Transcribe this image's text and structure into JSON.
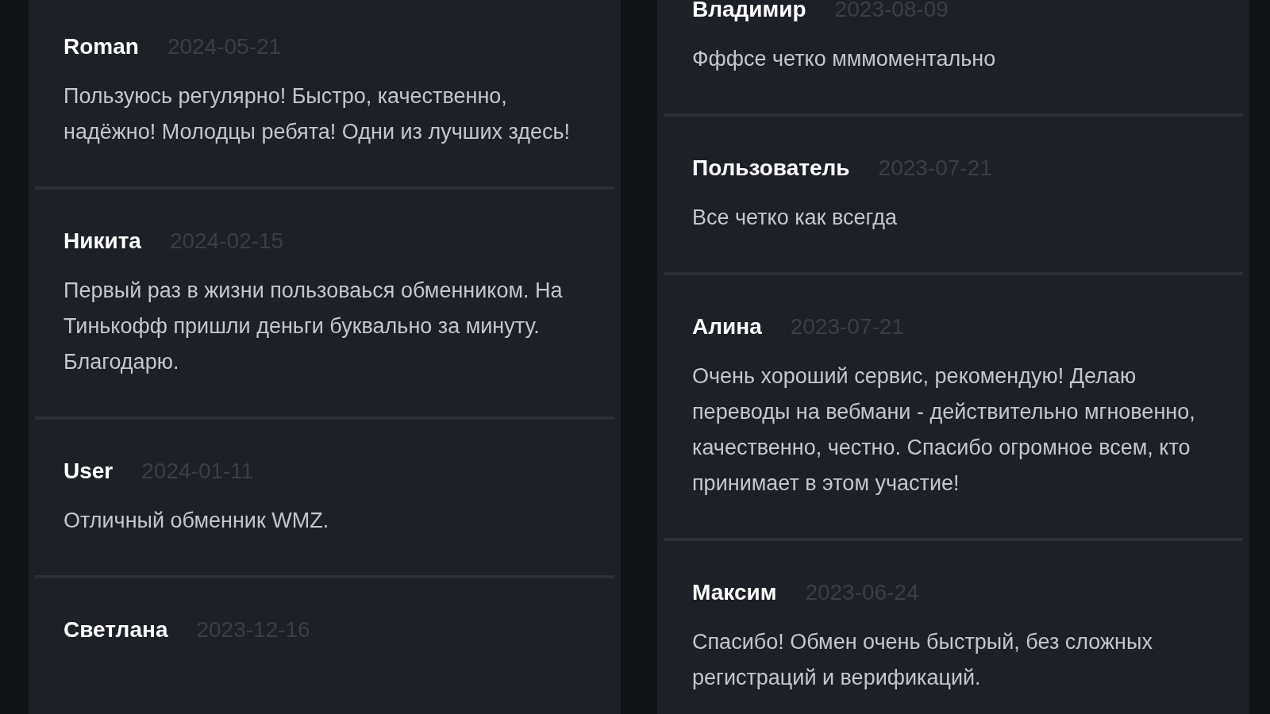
{
  "columns": [
    {
      "reviews": [
        {
          "author": "Roman",
          "date": "2024-05-21",
          "text": "Пользуюсь регулярно! Быстро, качественно, надёжно! Молодцы ребята! Одни из лучших здесь!"
        },
        {
          "author": "Никита",
          "date": "2024-02-15",
          "text": "Первый раз в жизни пользоваься обменником. На Тинькофф пришли деньги буквально за минуту. Благодарю."
        },
        {
          "author": "User",
          "date": "2024-01-11",
          "text": "Отличный обменник WMZ."
        },
        {
          "author": "Светлана",
          "date": "2023-12-16"
        }
      ]
    },
    {
      "reviews": [
        {
          "author": "Владимир",
          "date": "2023-08-09",
          "text": "Фффсе четко мммоментально"
        },
        {
          "author": "Пользователь",
          "date": "2023-07-21",
          "text": "Все четко как всегда"
        },
        {
          "author": "Алина",
          "date": "2023-07-21",
          "text": "Очень хороший сервис, рекомендую! Делаю переводы на вебмани - действительно мгновенно, качественно, честно. Спасибо огромное всем, кто принимает в этом участие!"
        },
        {
          "author": "Максим",
          "date": "2023-06-24",
          "text": "Спасибо! Обмен очень быстрый, без сложных регистраций и верификаций."
        }
      ]
    }
  ]
}
